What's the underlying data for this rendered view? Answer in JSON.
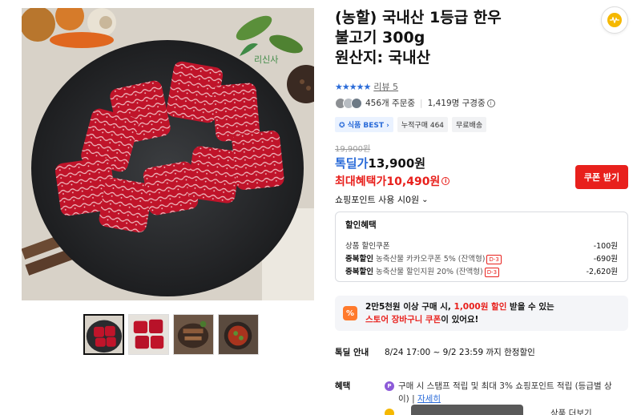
{
  "product": {
    "title_line1": "(농할) 국내산 1등급 한우",
    "title_line2": "불고기 300g",
    "title_line3": "원산지: 국내산",
    "image_watermark": "리신사"
  },
  "rating": {
    "stars": "★★★★★",
    "review_label": "리뷰 5"
  },
  "social": {
    "ordering": "456개 주문중",
    "watching": "1,419명 구경중"
  },
  "tags": [
    {
      "label": "식품 BEST",
      "icon": "badge-icon"
    },
    {
      "label": "누적구매 464"
    },
    {
      "label": "무료배송"
    }
  ],
  "price": {
    "original": "19,900원",
    "deal_label": "톡딜가",
    "deal_price": "13,900원",
    "max_label": "최대혜택가",
    "max_price": "10,490원",
    "coupon_button": "쿠폰 받기",
    "points_text": "쇼핑포인트 사용 시0원"
  },
  "discount": {
    "title": "할인혜택",
    "rows": [
      {
        "label": "상품 할인쿠폰",
        "bold": "",
        "desc": "",
        "badge": "",
        "amount": "-100원"
      },
      {
        "label": "",
        "bold": "중복할인",
        "desc": "농축산물 카카오쿠폰 5% (잔액형)",
        "badge": "D-3",
        "amount": "-690원"
      },
      {
        "label": "",
        "bold": "중복할인",
        "desc": "농축산물 할인지원 20% (잔액형)",
        "badge": "D-3",
        "amount": "-2,620원"
      }
    ]
  },
  "promo": {
    "icon": "%",
    "line1_a": "2만5천원 이상 구매 시, ",
    "line1_b": "1,000원 할인",
    "line1_c": " 받을 수 있는",
    "line2_a": "스토어 장바구니 쿠폰",
    "line2_b": "이 있어요!"
  },
  "deal_info": {
    "key": "톡딜 안내",
    "value": "8/24 17:00 ~ 9/2 23:59 까지 한정할인"
  },
  "benefit": {
    "key": "혜택",
    "icon": "P",
    "text": "구매 시 스탬프 적립 및 최대 3% 쇼핑포인트 적립 (등급별 상이)",
    "link": "자세히",
    "next_text": "상품 더보기"
  },
  "colors": {
    "accent_blue": "#2a6bd8",
    "accent_red": "#e8201c",
    "promo_orange": "#ff7a2c"
  }
}
